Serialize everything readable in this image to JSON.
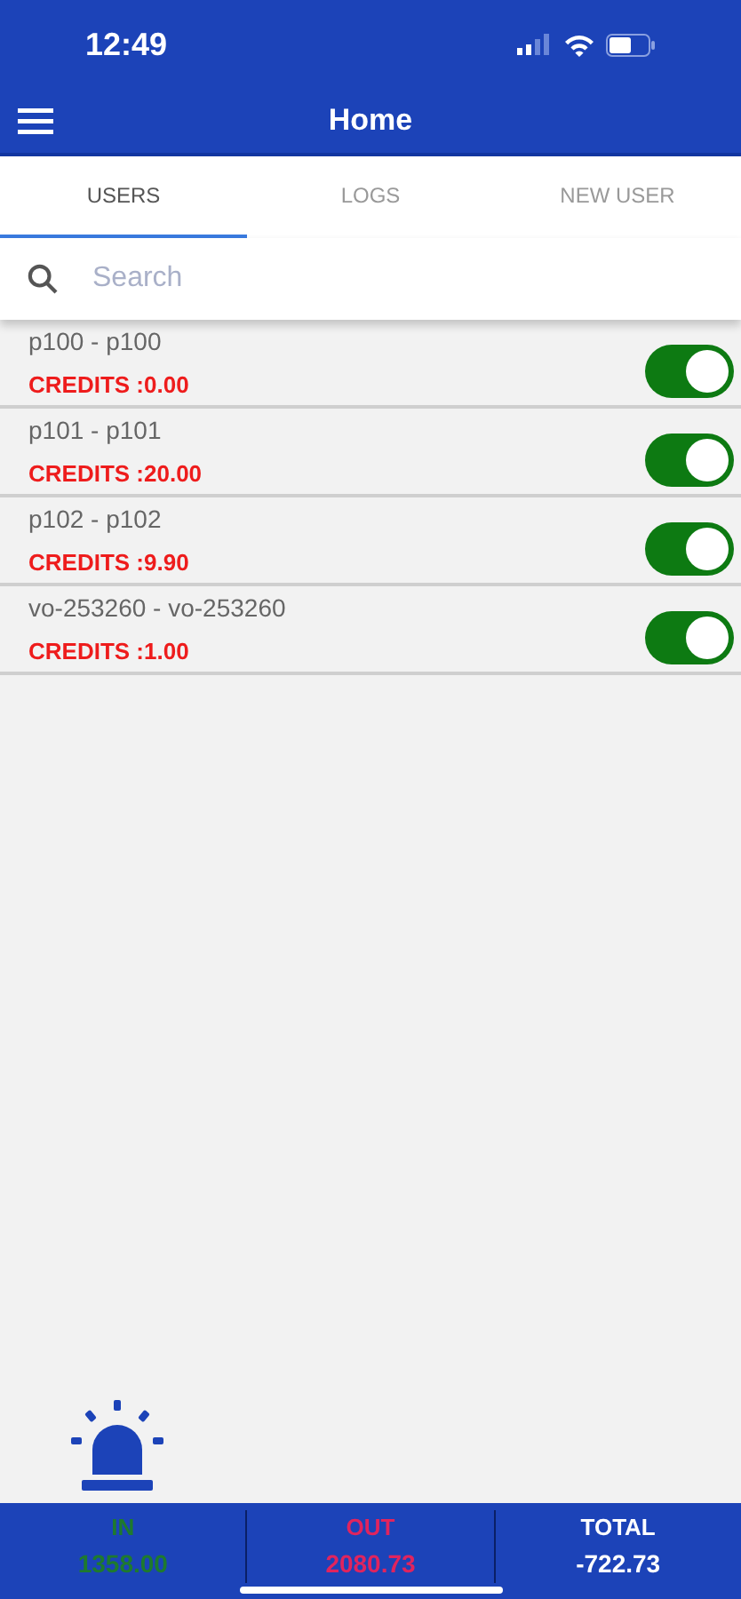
{
  "status_bar": {
    "time": "12:49"
  },
  "header": {
    "title": "Home"
  },
  "tabs": [
    {
      "label": "USERS",
      "selected": true
    },
    {
      "label": "LOGS",
      "selected": false
    },
    {
      "label": "NEW USER",
      "selected": false
    }
  ],
  "search": {
    "placeholder": "Search"
  },
  "users": [
    {
      "name": "p100 - p100",
      "credits": "CREDITS :0.00",
      "on": true
    },
    {
      "name": "p101 - p101",
      "credits": "CREDITS :20.00",
      "on": true
    },
    {
      "name": "p102 - p102",
      "credits": "CREDITS :9.90",
      "on": true
    },
    {
      "name": "vo-253260 - vo-253260",
      "credits": "CREDITS :1.00",
      "on": true
    }
  ],
  "totals": [
    {
      "kind": "in",
      "label": "IN",
      "value": "1358.00"
    },
    {
      "kind": "out",
      "label": "OUT",
      "value": "2080.73"
    },
    {
      "kind": "total",
      "label": "TOTAL",
      "value": "-722.73"
    }
  ]
}
